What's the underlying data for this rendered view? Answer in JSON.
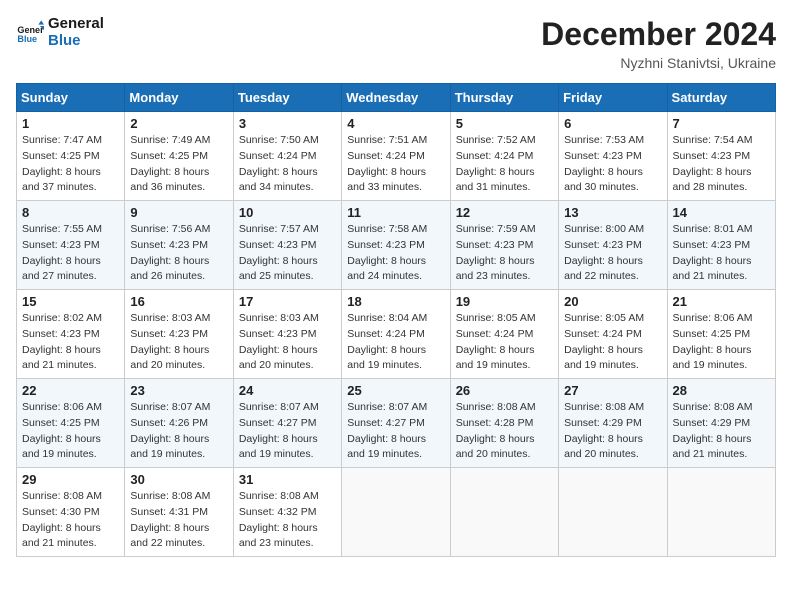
{
  "header": {
    "logo_line1": "General",
    "logo_line2": "Blue",
    "month_title": "December 2024",
    "subtitle": "Nyzhni Stanivtsi, Ukraine"
  },
  "weekdays": [
    "Sunday",
    "Monday",
    "Tuesday",
    "Wednesday",
    "Thursday",
    "Friday",
    "Saturday"
  ],
  "weeks": [
    [
      {
        "day": "1",
        "sunrise": "7:47 AM",
        "sunset": "4:25 PM",
        "daylight": "8 hours and 37 minutes."
      },
      {
        "day": "2",
        "sunrise": "7:49 AM",
        "sunset": "4:25 PM",
        "daylight": "8 hours and 36 minutes."
      },
      {
        "day": "3",
        "sunrise": "7:50 AM",
        "sunset": "4:24 PM",
        "daylight": "8 hours and 34 minutes."
      },
      {
        "day": "4",
        "sunrise": "7:51 AM",
        "sunset": "4:24 PM",
        "daylight": "8 hours and 33 minutes."
      },
      {
        "day": "5",
        "sunrise": "7:52 AM",
        "sunset": "4:24 PM",
        "daylight": "8 hours and 31 minutes."
      },
      {
        "day": "6",
        "sunrise": "7:53 AM",
        "sunset": "4:23 PM",
        "daylight": "8 hours and 30 minutes."
      },
      {
        "day": "7",
        "sunrise": "7:54 AM",
        "sunset": "4:23 PM",
        "daylight": "8 hours and 28 minutes."
      }
    ],
    [
      {
        "day": "8",
        "sunrise": "7:55 AM",
        "sunset": "4:23 PM",
        "daylight": "8 hours and 27 minutes."
      },
      {
        "day": "9",
        "sunrise": "7:56 AM",
        "sunset": "4:23 PM",
        "daylight": "8 hours and 26 minutes."
      },
      {
        "day": "10",
        "sunrise": "7:57 AM",
        "sunset": "4:23 PM",
        "daylight": "8 hours and 25 minutes."
      },
      {
        "day": "11",
        "sunrise": "7:58 AM",
        "sunset": "4:23 PM",
        "daylight": "8 hours and 24 minutes."
      },
      {
        "day": "12",
        "sunrise": "7:59 AM",
        "sunset": "4:23 PM",
        "daylight": "8 hours and 23 minutes."
      },
      {
        "day": "13",
        "sunrise": "8:00 AM",
        "sunset": "4:23 PM",
        "daylight": "8 hours and 22 minutes."
      },
      {
        "day": "14",
        "sunrise": "8:01 AM",
        "sunset": "4:23 PM",
        "daylight": "8 hours and 21 minutes."
      }
    ],
    [
      {
        "day": "15",
        "sunrise": "8:02 AM",
        "sunset": "4:23 PM",
        "daylight": "8 hours and 21 minutes."
      },
      {
        "day": "16",
        "sunrise": "8:03 AM",
        "sunset": "4:23 PM",
        "daylight": "8 hours and 20 minutes."
      },
      {
        "day": "17",
        "sunrise": "8:03 AM",
        "sunset": "4:23 PM",
        "daylight": "8 hours and 20 minutes."
      },
      {
        "day": "18",
        "sunrise": "8:04 AM",
        "sunset": "4:24 PM",
        "daylight": "8 hours and 19 minutes."
      },
      {
        "day": "19",
        "sunrise": "8:05 AM",
        "sunset": "4:24 PM",
        "daylight": "8 hours and 19 minutes."
      },
      {
        "day": "20",
        "sunrise": "8:05 AM",
        "sunset": "4:24 PM",
        "daylight": "8 hours and 19 minutes."
      },
      {
        "day": "21",
        "sunrise": "8:06 AM",
        "sunset": "4:25 PM",
        "daylight": "8 hours and 19 minutes."
      }
    ],
    [
      {
        "day": "22",
        "sunrise": "8:06 AM",
        "sunset": "4:25 PM",
        "daylight": "8 hours and 19 minutes."
      },
      {
        "day": "23",
        "sunrise": "8:07 AM",
        "sunset": "4:26 PM",
        "daylight": "8 hours and 19 minutes."
      },
      {
        "day": "24",
        "sunrise": "8:07 AM",
        "sunset": "4:27 PM",
        "daylight": "8 hours and 19 minutes."
      },
      {
        "day": "25",
        "sunrise": "8:07 AM",
        "sunset": "4:27 PM",
        "daylight": "8 hours and 19 minutes."
      },
      {
        "day": "26",
        "sunrise": "8:08 AM",
        "sunset": "4:28 PM",
        "daylight": "8 hours and 20 minutes."
      },
      {
        "day": "27",
        "sunrise": "8:08 AM",
        "sunset": "4:29 PM",
        "daylight": "8 hours and 20 minutes."
      },
      {
        "day": "28",
        "sunrise": "8:08 AM",
        "sunset": "4:29 PM",
        "daylight": "8 hours and 21 minutes."
      }
    ],
    [
      {
        "day": "29",
        "sunrise": "8:08 AM",
        "sunset": "4:30 PM",
        "daylight": "8 hours and 21 minutes."
      },
      {
        "day": "30",
        "sunrise": "8:08 AM",
        "sunset": "4:31 PM",
        "daylight": "8 hours and 22 minutes."
      },
      {
        "day": "31",
        "sunrise": "8:08 AM",
        "sunset": "4:32 PM",
        "daylight": "8 hours and 23 minutes."
      },
      null,
      null,
      null,
      null
    ]
  ],
  "labels": {
    "sunrise": "Sunrise:",
    "sunset": "Sunset:",
    "daylight": "Daylight:"
  }
}
